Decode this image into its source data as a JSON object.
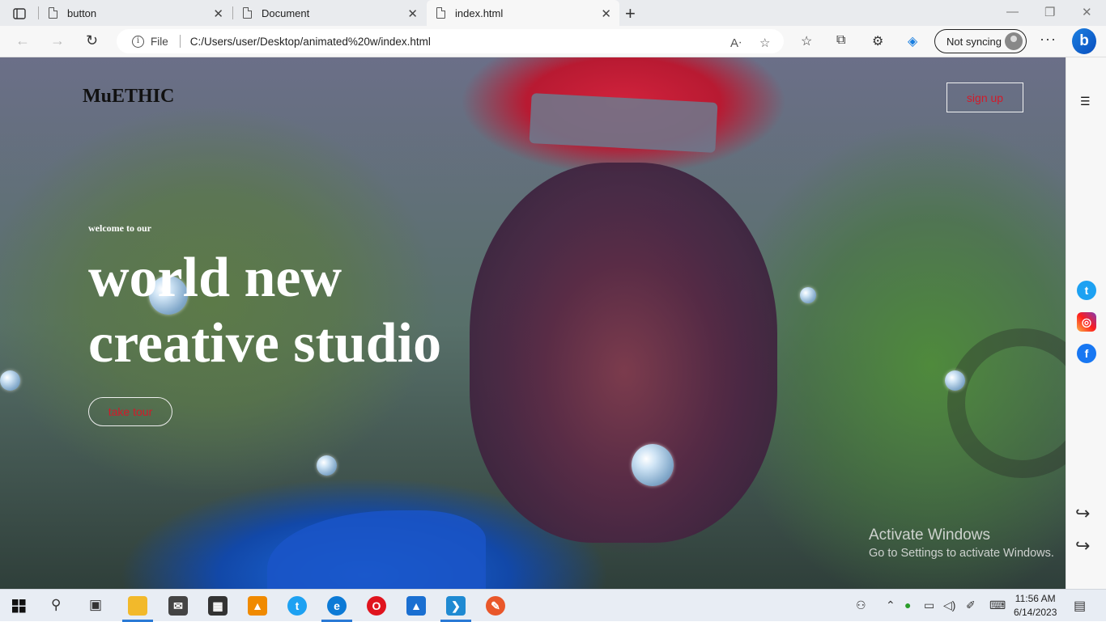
{
  "browser": {
    "tabs": [
      {
        "title": "button"
      },
      {
        "title": "Document"
      },
      {
        "title": "index.html"
      }
    ],
    "address": {
      "file_label": "File",
      "url": "C:/Users/user/Desktop/animated%20w/index.html"
    },
    "sync_label": "Not syncing"
  },
  "page": {
    "brand": "MuETHIC",
    "signup_label": "sign up",
    "welcome": "welcome to our",
    "headline_line1": "world new",
    "headline_line2": "creative studio",
    "tour_label": "take tour",
    "watermark_title": "Activate Windows",
    "watermark_sub": "Go to Settings to activate Windows."
  },
  "taskbar": {
    "time": "11:56 AM",
    "date": "6/14/2023"
  },
  "colors": {
    "accent_red": "#d21a2a",
    "brand_text": "#111111"
  }
}
